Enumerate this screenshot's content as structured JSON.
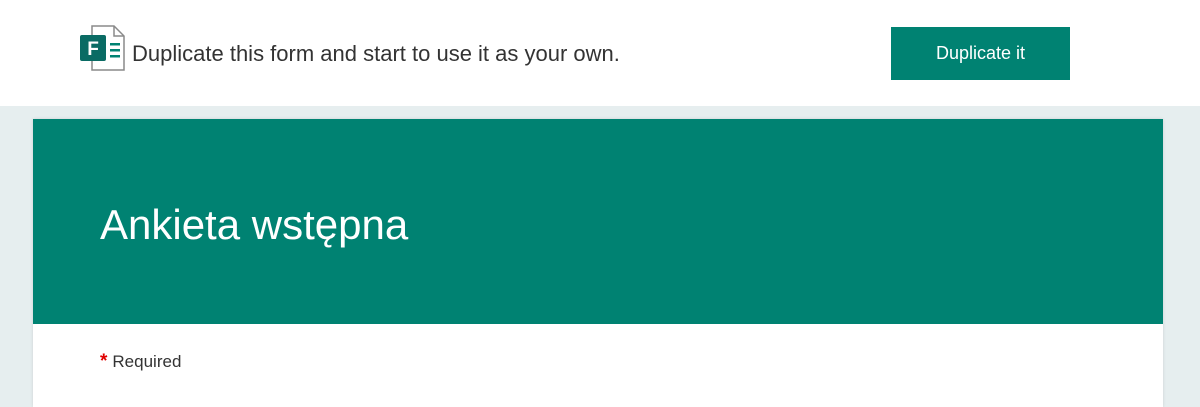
{
  "banner": {
    "message": "Duplicate this form and start to use it as your own.",
    "button_label": "Duplicate it",
    "logo_icon": "microsoft-forms-icon",
    "logo_letter": "F"
  },
  "form": {
    "title": "Ankieta wstępna",
    "required_star": "*",
    "required_label": "Required"
  },
  "colors": {
    "accent": "#008272",
    "required_star": "#e00000",
    "page_background": "#e6eeef"
  }
}
